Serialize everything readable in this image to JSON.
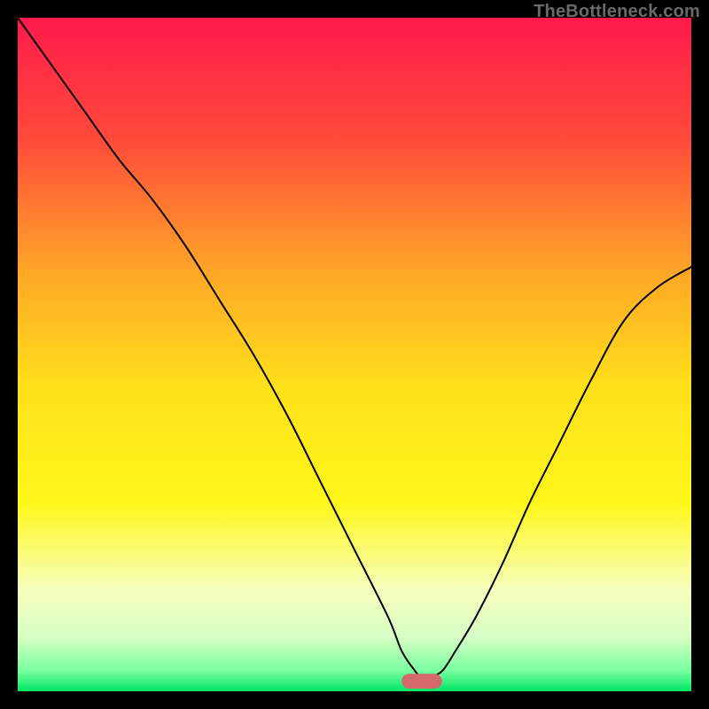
{
  "attribution": "TheBottleneck.com",
  "chart_data": {
    "type": "line",
    "title": "",
    "xlabel": "",
    "ylabel": "",
    "xlim": [
      0,
      100
    ],
    "ylim": [
      0,
      100
    ],
    "grid": false,
    "legend": false,
    "background_gradient_stops": [
      {
        "offset": 0.0,
        "color": "#ff1a4b"
      },
      {
        "offset": 0.18,
        "color": "#ff4a3a"
      },
      {
        "offset": 0.38,
        "color": "#ffa726"
      },
      {
        "offset": 0.55,
        "color": "#ffe11a"
      },
      {
        "offset": 0.72,
        "color": "#fff71a"
      },
      {
        "offset": 0.85,
        "color": "#f6ffbe"
      },
      {
        "offset": 0.92,
        "color": "#d7ffc4"
      },
      {
        "offset": 0.97,
        "color": "#77ff9e"
      },
      {
        "offset": 1.0,
        "color": "#00e765"
      }
    ],
    "series": [
      {
        "name": "bottleneck-curve",
        "color": "#000000",
        "x": [
          0,
          5,
          10,
          15,
          20,
          25,
          30,
          35,
          40,
          45,
          50,
          55,
          57,
          59,
          60,
          61,
          63,
          65,
          68,
          72,
          76,
          80,
          85,
          90,
          95,
          100
        ],
        "values": [
          100,
          93,
          86,
          79,
          73,
          66,
          58,
          50,
          41,
          31,
          21,
          11,
          6,
          3,
          2,
          2,
          3,
          6,
          11,
          19,
          28,
          36,
          46,
          55,
          60,
          63
        ]
      }
    ],
    "marker": {
      "name": "optimal-range",
      "color": "#d66a6a",
      "shape": "pill",
      "x_center": 60,
      "x_half_width": 3,
      "y": 1.5,
      "height": 2.2
    }
  }
}
